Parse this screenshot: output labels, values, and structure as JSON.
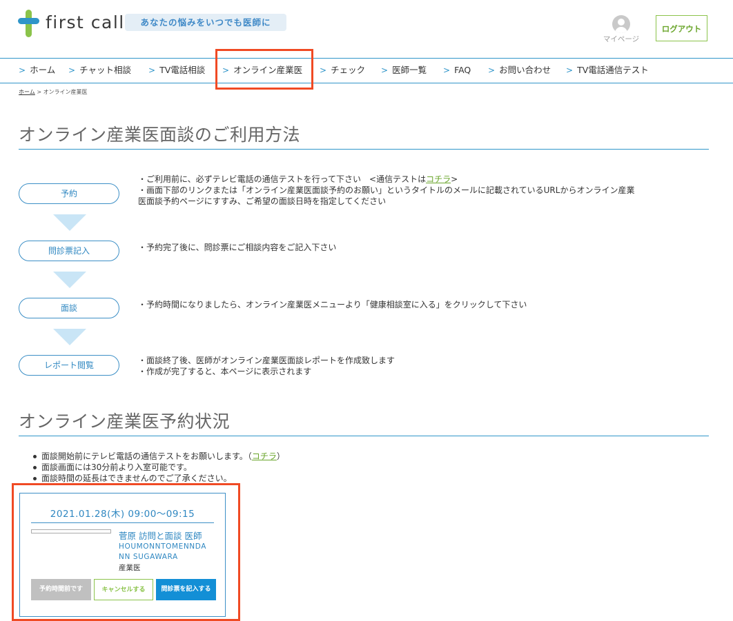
{
  "header": {
    "logo_text": "first call",
    "tagline": "あなたの悩みをいつでも医師に",
    "mypage_label": "マイページ",
    "logout_label": "ログアウト",
    "colors": {
      "accent_blue": "#2f95c9",
      "accent_green": "#8bc34a",
      "highlight_red": "#f04a24"
    }
  },
  "nav": {
    "items": [
      {
        "label": "ホーム"
      },
      {
        "label": "チャット相談"
      },
      {
        "label": "TV電話相談"
      },
      {
        "label": "オンライン産業医"
      },
      {
        "label": "チェック"
      },
      {
        "label": "医師一覧"
      },
      {
        "label": "FAQ"
      },
      {
        "label": "お問い合わせ"
      },
      {
        "label": "TV電話通信テスト"
      }
    ]
  },
  "breadcrumb": {
    "home": "ホーム",
    "separator": ">",
    "current": "オンライン産業医"
  },
  "usage": {
    "title": "オンライン産業医面談のご利用方法",
    "steps": [
      {
        "label": "予約",
        "desc_1_pre": "・ご利用前に、必ずテレビ電話の通信テストを行って下さい　<通信テストは",
        "desc_1_link": "コチラ",
        "desc_1_post": ">",
        "desc_2": "・画面下部のリンクまたは「オンライン産業医面談予約のお願い」というタイトルのメールに記載されているURLからオンライン産業",
        "desc_3": "医面談予約ページにすすみ、ご希望の面談日時を指定してください"
      },
      {
        "label": "問診票記入",
        "desc_1": "・予約完了後に、問診票にご相談内容をご記入下さい"
      },
      {
        "label": "面談",
        "desc_1": "・予約時間になりましたら、オンライン産業医メニューより「健康相談室に入る」をクリックして下さい"
      },
      {
        "label": "レポート閲覧",
        "desc_1": "・面談終了後、医師がオンライン産業医面談レポートを作成致します",
        "desc_2": "・作成が完了すると、本ページに表示されます"
      }
    ]
  },
  "reservations": {
    "title": "オンライン産業医予約状況",
    "notes": {
      "n1_pre": "面談開始前にテレビ電話の通信テストをお願いします。（",
      "n1_link": "コチラ",
      "n1_post": "）",
      "n2": "面談画面には30分前より入室可能です。",
      "n3": "面談時間の延長はできませんのでご了承ください。"
    },
    "card": {
      "datetime": "2021.01.28(木) 09:00～09:15",
      "doctor_name": "菅原 訪問と面談 医師",
      "doctor_roman_1": "HOUMONNTOMENNDA",
      "doctor_roman_2": "NN SUGAWARA",
      "doctor_role": "産業医",
      "btn_before_time": "予約時間前です",
      "btn_cancel": "キャンセルする",
      "btn_questionnaire": "問診票を記入する"
    }
  }
}
